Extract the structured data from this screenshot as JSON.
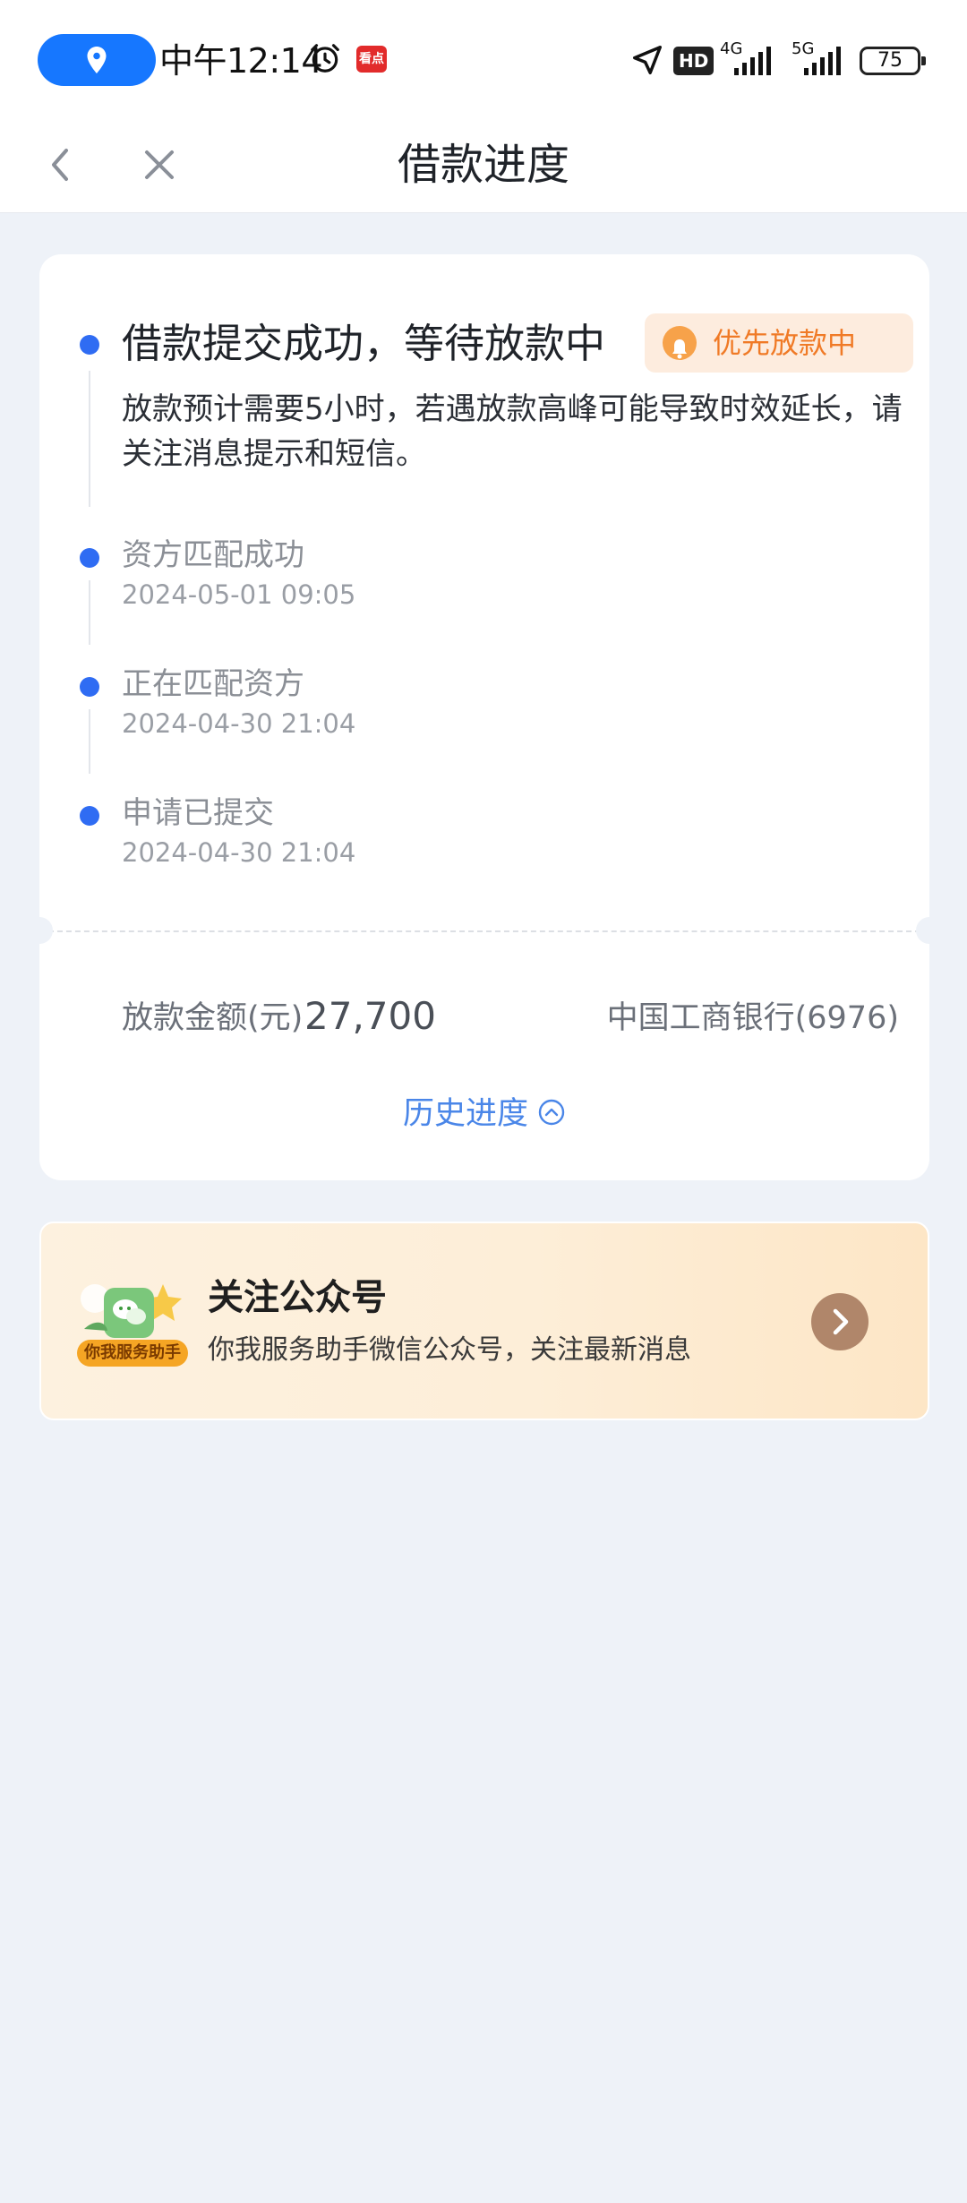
{
  "status_bar": {
    "time": "中午12:14",
    "news_icon_text": "看点",
    "hd_label": "HD",
    "network_1": "4G",
    "network_2": "5G",
    "battery": "75"
  },
  "nav": {
    "title": "借款进度",
    "back_icon": "chevron-left-icon",
    "close_icon": "close-icon"
  },
  "progress": {
    "current": {
      "title": "借款提交成功，等待放款中",
      "badge": "优先放款中",
      "description": "放款预计需要5小时，若遇放款高峰可能导致时效延长，请关注消息提示和短信。"
    },
    "steps": [
      {
        "title": "资方匹配成功",
        "time": "2024-05-01 09:05"
      },
      {
        "title": "正在匹配资方",
        "time": "2024-04-30 21:04"
      },
      {
        "title": "申请已提交",
        "time": "2024-04-30 21:04"
      }
    ],
    "amount_label": "放款金额(元)",
    "amount_value": "27,700",
    "bank": "中国工商银行(6976)",
    "history_link": "历史进度"
  },
  "banner": {
    "title": "关注公众号",
    "subtitle": "你我服务助手微信公众号，关注最新消息",
    "logo_caption": "你我服务助手"
  },
  "colors": {
    "accent_blue": "#2f6cf3",
    "badge_orange": "#f07a26",
    "link_blue": "#4a86e8",
    "page_bg": "#eef2f8"
  }
}
